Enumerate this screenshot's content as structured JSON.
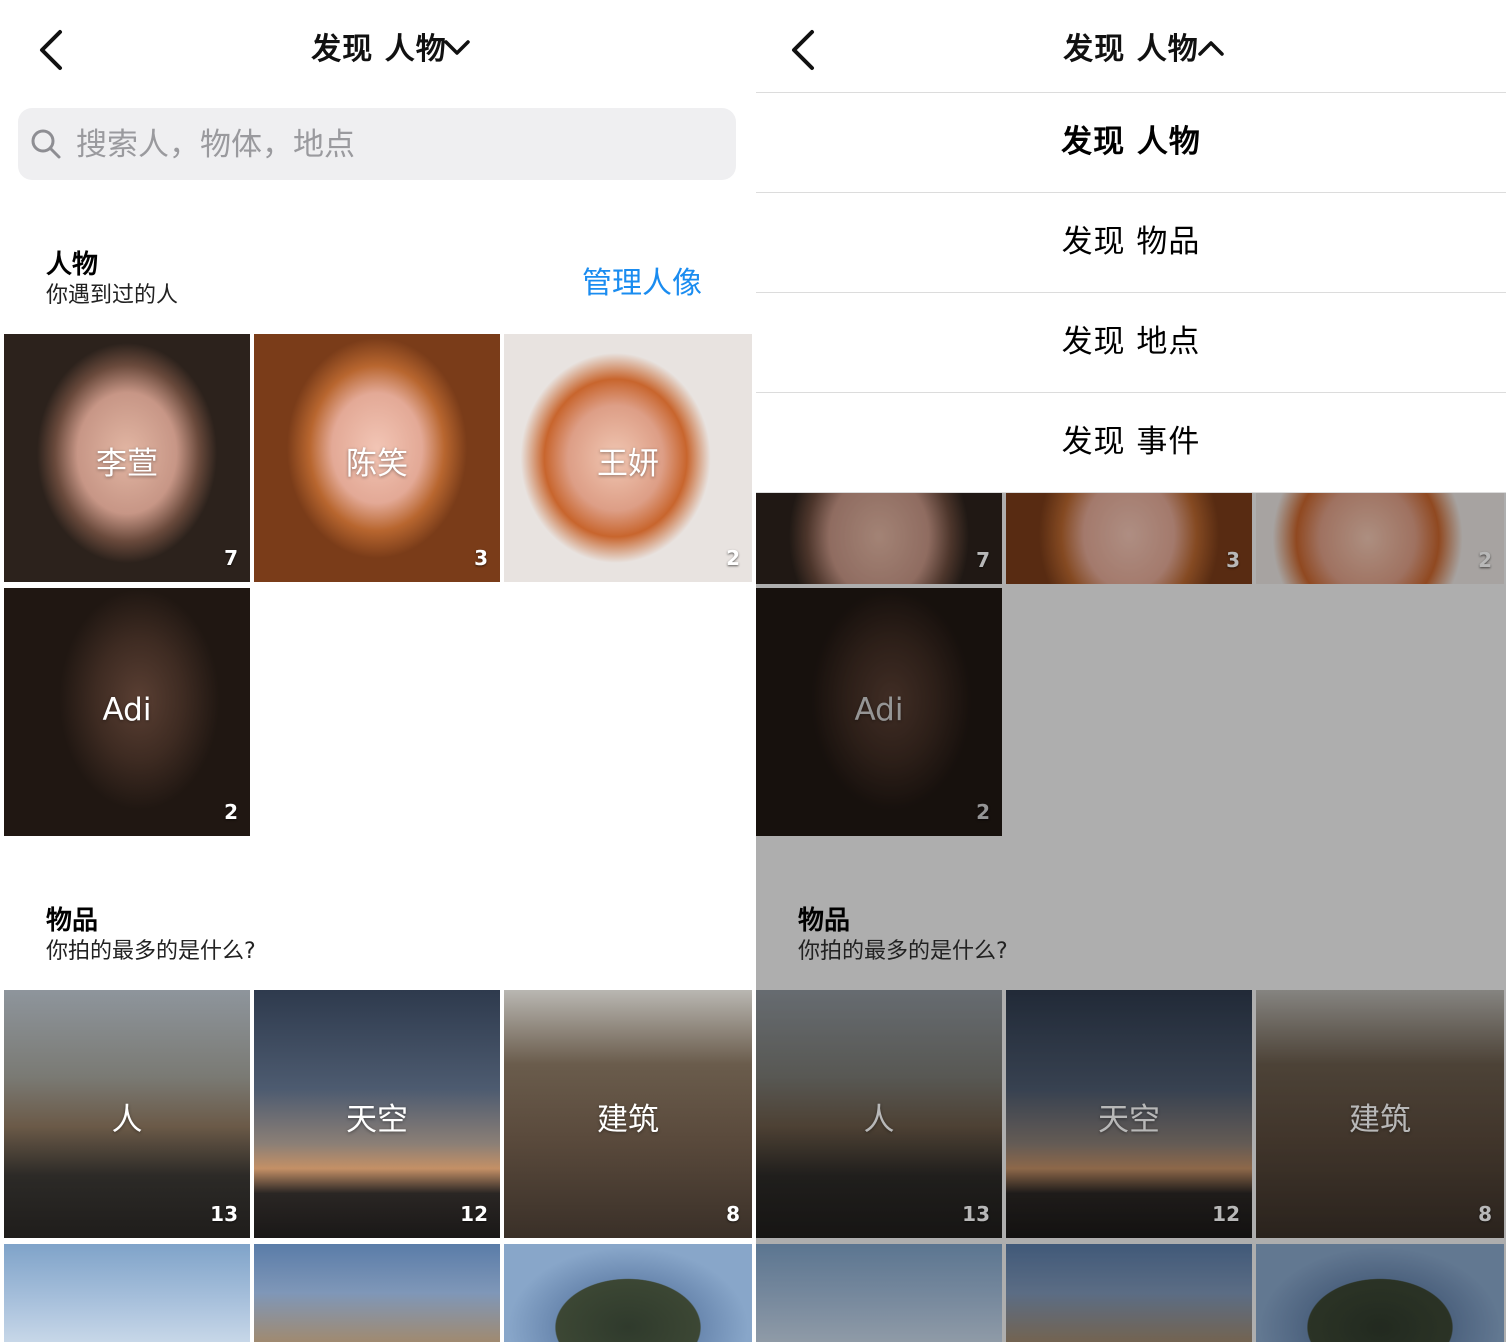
{
  "left": {
    "nav": {
      "title": "发现 人物",
      "title_chevron": "chevron-down-icon"
    },
    "search": {
      "placeholder": "搜索人，物体，地点"
    },
    "people_section": {
      "title": "人物",
      "subtitle": "你遇到过的人",
      "action": "管理人像"
    },
    "people": [
      {
        "name": "李萱",
        "count": "7"
      },
      {
        "name": "陈笑",
        "count": "3"
      },
      {
        "name": "王妍",
        "count": "2"
      },
      {
        "name": "Adi",
        "count": "2"
      }
    ],
    "things_section": {
      "title": "物品",
      "subtitle": "你拍的最多的是什么?"
    },
    "things": [
      {
        "name": "人",
        "count": "13"
      },
      {
        "name": "天空",
        "count": "12"
      },
      {
        "name": "建筑",
        "count": "8"
      }
    ]
  },
  "right": {
    "nav": {
      "title": "发现 人物",
      "title_chevron": "chevron-up-icon"
    },
    "menu": [
      {
        "label": "发现 人物",
        "selected": true
      },
      {
        "label": "发现 物品",
        "selected": false
      },
      {
        "label": "发现 地点",
        "selected": false
      },
      {
        "label": "发现 事件",
        "selected": false
      }
    ],
    "people_counts": [
      "7",
      "3",
      "2"
    ],
    "adi": {
      "name": "Adi",
      "count": "2"
    },
    "things_section": {
      "title": "物品",
      "subtitle": "你拍的最多的是什么?"
    },
    "things": [
      {
        "name": "人",
        "count": "13"
      },
      {
        "name": "天空",
        "count": "12"
      },
      {
        "name": "建筑",
        "count": "8"
      }
    ]
  },
  "colors": {
    "accent": "#1a8cf0",
    "search_bg": "#efeff1",
    "overlay": "#aeaeae"
  }
}
